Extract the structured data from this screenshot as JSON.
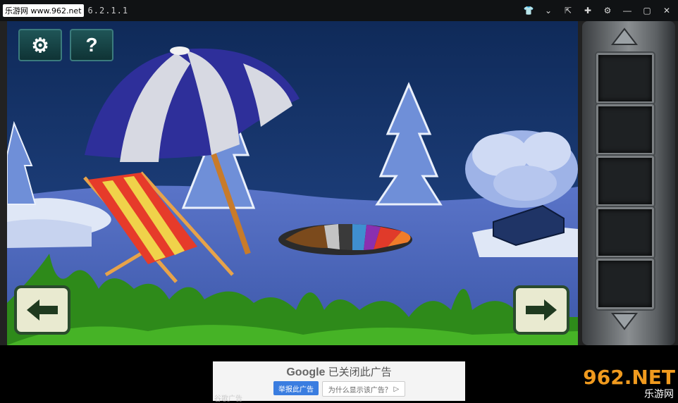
{
  "titlebar": {
    "site_badge": "乐游网 www.962.net",
    "app_title": "6.2.1.1",
    "controls": [
      "shirt-icon",
      "chevron-down-icon",
      "pin-icon",
      "puzzle-icon",
      "gear-icon",
      "minimize-icon",
      "maximize-icon",
      "close-icon"
    ]
  },
  "hud": {
    "settings_icon": "gear-icon",
    "help_label": "?"
  },
  "navigation": {
    "left_arrow_icon": "arrow-left-icon",
    "right_arrow_icon": "arrow-right-icon"
  },
  "inventory": {
    "slots": 5,
    "up_icon": "triangle-up-icon",
    "down_icon": "triangle-down-icon"
  },
  "ad": {
    "google": "Google",
    "closed_text": "已关闭此广告",
    "report_button": "举报此广告",
    "why_button": "为什么显示该广告？",
    "footer": "谷歌广告"
  },
  "logo": {
    "text": "962.NET",
    "sub": "乐游网"
  },
  "colors": {
    "sky": "#1f3f7a",
    "snow": "#dfe7f6",
    "grass": "#3c9a21",
    "umbrella_blue": "#2e2f9a",
    "umbrella_white": "#d7d9e2"
  }
}
